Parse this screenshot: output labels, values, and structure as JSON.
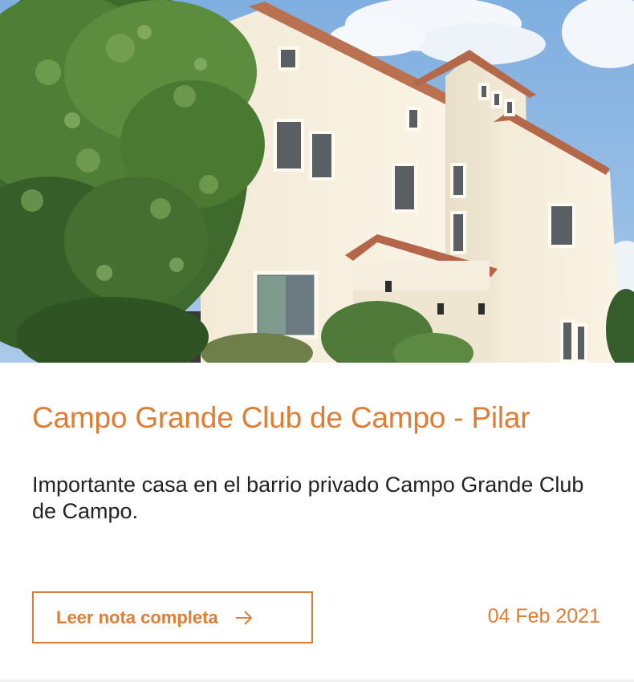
{
  "card": {
    "image_alt": "Campo Grande Club de Campo - Pilar",
    "title": "Campo Grande Club de Campo - Pilar",
    "description": "Importante casa en el barrio privado Campo Grande Club de Campo.",
    "read_more_label": "Leer nota completa",
    "read_more_icon": "arrow-right-icon",
    "date": "04 Feb 2021"
  },
  "colors": {
    "accent": "#e07d35",
    "text": "#222222",
    "background": "#ffffff"
  }
}
